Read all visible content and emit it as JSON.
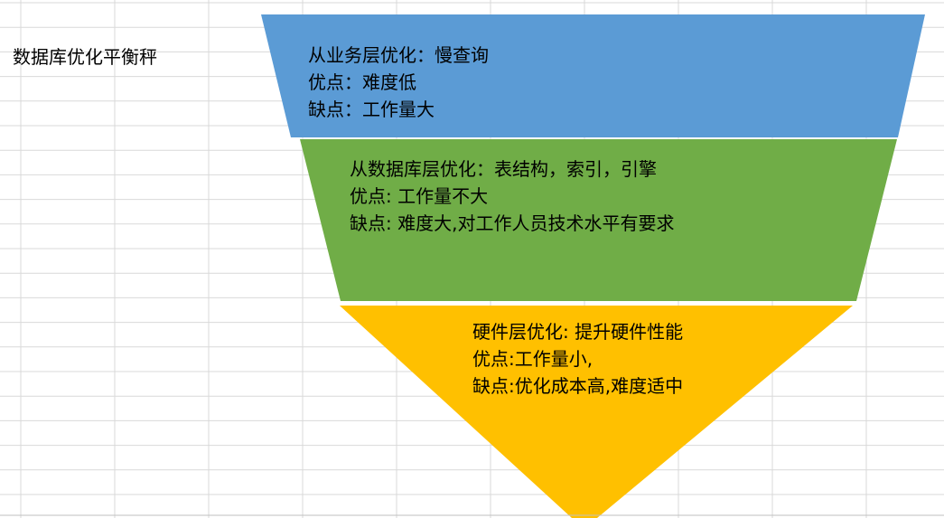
{
  "sheet_title": "数据库优化平衡秤",
  "colors": {
    "tier_1_fill": "#5B9BD5",
    "tier_2_fill": "#70AD47",
    "tier_3_fill": "#FFC000",
    "gridline": "#D9D9D9"
  },
  "tiers": [
    {
      "title": "从业务层优化：慢查询",
      "pros": "优点：难度低",
      "cons": "缺点：工作量大"
    },
    {
      "title": "从数据库层优化：表结构，索引，引擎",
      "pros": "优点: 工作量不大",
      "cons": "缺点: 难度大,对工作人员技术水平有要求"
    },
    {
      "title": "硬件层优化: 提升硬件性能",
      "pros": "优点:工作量小,",
      "cons": "缺点:优化成本高,难度适中"
    }
  ]
}
